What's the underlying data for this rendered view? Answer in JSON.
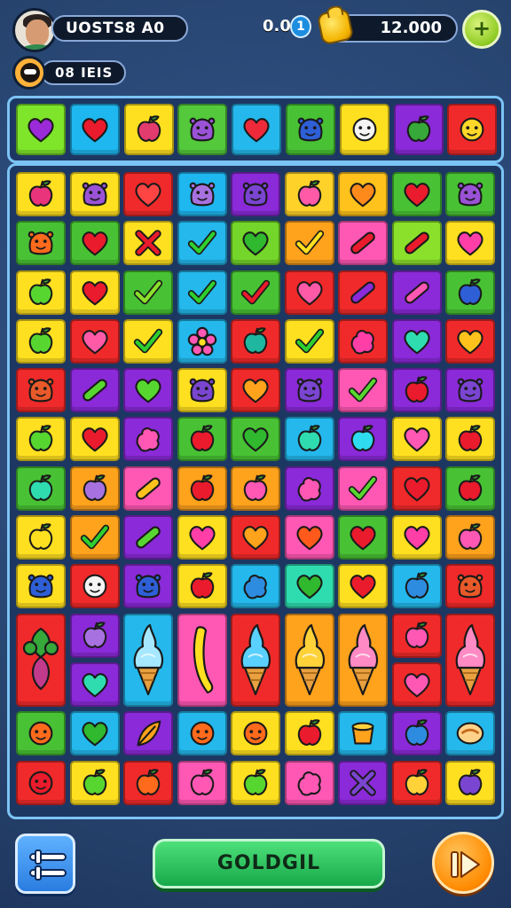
{
  "player": {
    "name": "UOSTS8 A0",
    "level_label": "08 IEIS"
  },
  "score": {
    "value": "0.0",
    "badge": "1"
  },
  "coins": {
    "value": "12.000"
  },
  "buttons": {
    "add": "+",
    "go_label": "GOLDGIL"
  },
  "colors": {
    "background": "#2c4a7e",
    "board_border": "#7cc3f5",
    "go_button": "#1fc25a",
    "play_button": "#ff8a00"
  },
  "target_strip": [
    {
      "bg": "#7ee52a",
      "icon": "heart-icon",
      "fg": "#9b2ad8"
    },
    {
      "bg": "#1fb7f0",
      "icon": "heart-icon",
      "fg": "#ea1b2c"
    },
    {
      "bg": "#ffe020",
      "icon": "fruit-icon",
      "fg": "#e23b6e"
    },
    {
      "bg": "#54c93b",
      "icon": "monster-icon",
      "fg": "#9a52d6"
    },
    {
      "bg": "#24b8ec",
      "icon": "heart-icon",
      "fg": "#ee2a3a"
    },
    {
      "bg": "#48c234",
      "icon": "monster-icon",
      "fg": "#2e5fd6"
    },
    {
      "bg": "#ffe020",
      "icon": "face-icon",
      "fg": "#f4f4f4"
    },
    {
      "bg": "#8a2ad8",
      "icon": "fruit-icon",
      "fg": "#37a83a"
    },
    {
      "bg": "#f02a2a",
      "icon": "face-icon",
      "fg": "#ffd82a"
    }
  ],
  "board": [
    {
      "bg": "#ffe020",
      "icon": "fruit-icon",
      "fg": "#e9337a"
    },
    {
      "bg": "#ffe020",
      "icon": "monster-icon",
      "fg": "#9a52d6"
    },
    {
      "bg": "#f02a2a",
      "icon": "heart-icon",
      "fg": "#ff4444"
    },
    {
      "bg": "#1fb7f0",
      "icon": "monster-icon",
      "fg": "#a772df"
    },
    {
      "bg": "#8a2ad8",
      "icon": "monster-icon",
      "fg": "#7a45d0"
    },
    {
      "bg": "#ffd22a",
      "icon": "fruit-icon",
      "fg": "#ff5aa8"
    },
    {
      "bg": "#ffc21c",
      "icon": "heart-icon",
      "fg": "#ff8a1c"
    },
    {
      "bg": "#48c234",
      "icon": "heart-icon",
      "fg": "#ea1b2c"
    },
    {
      "bg": "#48c234",
      "icon": "monster-icon",
      "fg": "#9a52d6"
    },
    {
      "bg": "#48c234",
      "icon": "monster-icon",
      "fg": "#ff6a1c"
    },
    {
      "bg": "#48c234",
      "icon": "heart-icon",
      "fg": "#ea1b2c"
    },
    {
      "bg": "#ffe020",
      "icon": "cross-icon",
      "fg": "#ea1b2c"
    },
    {
      "bg": "#24b8ec",
      "icon": "check-icon",
      "fg": "#2fcf2f"
    },
    {
      "bg": "#74d62a",
      "icon": "heart-icon",
      "fg": "#30b82e"
    },
    {
      "bg": "#ffa21c",
      "icon": "check-icon",
      "fg": "#ffe020"
    },
    {
      "bg": "#ff58b4",
      "icon": "bar-icon",
      "fg": "#ea1b2c"
    },
    {
      "bg": "#8ae02a",
      "icon": "bar-icon",
      "fg": "#ea1b2c"
    },
    {
      "bg": "#ffe020",
      "icon": "heart-icon",
      "fg": "#ff3ea8"
    },
    {
      "bg": "#ffe020",
      "icon": "fruit-icon",
      "fg": "#58d630"
    },
    {
      "bg": "#ffe020",
      "icon": "heart-icon",
      "fg": "#ea1b2c"
    },
    {
      "bg": "#48c234",
      "icon": "check-icon",
      "fg": "#8ae02a"
    },
    {
      "bg": "#24b8ec",
      "icon": "check-icon",
      "fg": "#2fcf2f"
    },
    {
      "bg": "#48c234",
      "icon": "check-icon",
      "fg": "#ea1b2c"
    },
    {
      "bg": "#f02a2a",
      "icon": "heart-icon",
      "fg": "#ff5aa8"
    },
    {
      "bg": "#f02a2a",
      "icon": "bar-icon",
      "fg": "#8a2ad8"
    },
    {
      "bg": "#8a2ad8",
      "icon": "bar-icon",
      "fg": "#ff58b4"
    },
    {
      "bg": "#48c234",
      "icon": "fruit-icon",
      "fg": "#2e5fd6"
    },
    {
      "bg": "#ffe020",
      "icon": "fruit-icon",
      "fg": "#58d630"
    },
    {
      "bg": "#f02a2a",
      "icon": "heart-icon",
      "fg": "#ff5aa8"
    },
    {
      "bg": "#ffe020",
      "icon": "check-icon",
      "fg": "#2fcf2f"
    },
    {
      "bg": "#24b8ec",
      "icon": "flower-icon",
      "fg": "#ff58b4"
    },
    {
      "bg": "#f02a2a",
      "icon": "fruit-icon",
      "fg": "#1fb7a0"
    },
    {
      "bg": "#ffe020",
      "icon": "check-icon",
      "fg": "#2fcf2f"
    },
    {
      "bg": "#f02a2a",
      "icon": "blob-icon",
      "fg": "#ff3ea8"
    },
    {
      "bg": "#8a2ad8",
      "icon": "heart-icon",
      "fg": "#2fdcb0"
    },
    {
      "bg": "#f02a2a",
      "icon": "heart-icon",
      "fg": "#ffc21c"
    },
    {
      "bg": "#f02a2a",
      "icon": "monster-icon",
      "fg": "#e85a2a"
    },
    {
      "bg": "#8a2ad8",
      "icon": "bar-icon",
      "fg": "#58d630"
    },
    {
      "bg": "#8a2ad8",
      "icon": "heart-icon",
      "fg": "#58d630"
    },
    {
      "bg": "#ffe020",
      "icon": "monster-icon",
      "fg": "#7a45d0"
    },
    {
      "bg": "#f02a2a",
      "icon": "heart-icon",
      "fg": "#ffa21c"
    },
    {
      "bg": "#8a2ad8",
      "icon": "monster-icon",
      "fg": "#7a45d0"
    },
    {
      "bg": "#ff58b4",
      "icon": "check-icon",
      "fg": "#58d630"
    },
    {
      "bg": "#8a2ad8",
      "icon": "fruit-icon",
      "fg": "#ea1b2c"
    },
    {
      "bg": "#8a2ad8",
      "icon": "monster-icon",
      "fg": "#7a45d0"
    },
    {
      "bg": "#ffe020",
      "icon": "fruit-icon",
      "fg": "#58d630"
    },
    {
      "bg": "#ffe020",
      "icon": "heart-icon",
      "fg": "#ea1b2c"
    },
    {
      "bg": "#8a2ad8",
      "icon": "blob-icon",
      "fg": "#ff58b4"
    },
    {
      "bg": "#48c234",
      "icon": "fruit-icon",
      "fg": "#ea1b2c"
    },
    {
      "bg": "#48c234",
      "icon": "heart-icon",
      "fg": "#30b82e"
    },
    {
      "bg": "#24b8ec",
      "icon": "fruit-icon",
      "fg": "#2fdcb0"
    },
    {
      "bg": "#8a2ad8",
      "icon": "fruit-icon",
      "fg": "#2fdcef"
    },
    {
      "bg": "#ffe020",
      "icon": "heart-icon",
      "fg": "#ff58b4"
    },
    {
      "bg": "#ffe020",
      "icon": "fruit-icon",
      "fg": "#ea1b2c"
    },
    {
      "bg": "#48c234",
      "icon": "fruit-icon",
      "fg": "#2fdcb0"
    },
    {
      "bg": "#ffa21c",
      "icon": "fruit-icon",
      "fg": "#a772df"
    },
    {
      "bg": "#ff58b4",
      "icon": "bar-icon",
      "fg": "#ffc21c"
    },
    {
      "bg": "#ffa21c",
      "icon": "fruit-icon",
      "fg": "#ea1b2c"
    },
    {
      "bg": "#ffa21c",
      "icon": "fruit-icon",
      "fg": "#ff58b4"
    },
    {
      "bg": "#8a2ad8",
      "icon": "blob-icon",
      "fg": "#ff58b4"
    },
    {
      "bg": "#ff58b4",
      "icon": "check-icon",
      "fg": "#58d630"
    },
    {
      "bg": "#f02a2a",
      "icon": "heart-icon",
      "fg": "#ea1b2c"
    },
    {
      "bg": "#48c234",
      "icon": "fruit-icon",
      "fg": "#ea1b2c"
    },
    {
      "bg": "#ffe020",
      "icon": "fruit-icon",
      "fg": "#ffe020"
    },
    {
      "bg": "#ffa21c",
      "icon": "check-icon",
      "fg": "#2fcf2f"
    },
    {
      "bg": "#8a2ad8",
      "icon": "bar-icon",
      "fg": "#58d630"
    },
    {
      "bg": "#ffe020",
      "icon": "heart-icon",
      "fg": "#ff3ea8"
    },
    {
      "bg": "#f02a2a",
      "icon": "heart-icon",
      "fg": "#ffa21c"
    },
    {
      "bg": "#ff58b4",
      "icon": "heart-icon",
      "fg": "#ff5a1c"
    },
    {
      "bg": "#48c234",
      "icon": "heart-icon",
      "fg": "#ea1b2c"
    },
    {
      "bg": "#ffe020",
      "icon": "heart-icon",
      "fg": "#ff3ea8"
    },
    {
      "bg": "#ffa21c",
      "icon": "fruit-icon",
      "fg": "#ff58b4"
    },
    {
      "bg": "#ffe020",
      "icon": "monster-icon",
      "fg": "#2e5fd6"
    },
    {
      "bg": "#f02a2a",
      "icon": "face-icon",
      "fg": "#f4f4f4"
    },
    {
      "bg": "#8a2ad8",
      "icon": "monster-icon",
      "fg": "#2e5fd6"
    },
    {
      "bg": "#ffe020",
      "icon": "fruit-icon",
      "fg": "#ea1b2c"
    },
    {
      "bg": "#24b8ec",
      "icon": "blob-icon",
      "fg": "#2e8ce0"
    },
    {
      "bg": "#2fdcb0",
      "icon": "heart-icon",
      "fg": "#30b82e"
    },
    {
      "bg": "#ffe020",
      "icon": "heart-icon",
      "fg": "#ea1b2c"
    },
    {
      "bg": "#24b8ec",
      "icon": "fruit-icon",
      "fg": "#2e8ce0"
    },
    {
      "bg": "#f02a2a",
      "icon": "monster-icon",
      "fg": "#e85a2a"
    },
    {
      "bg": "#f02a2a",
      "icon": "plant-icon",
      "fg": "#37a83a",
      "tall": true
    },
    {
      "bg": "#8a2ad8",
      "icon": "fruit-icon",
      "fg": "#a772df"
    },
    {
      "bg": "#24b8ec",
      "icon": "icecream-icon",
      "fg": "#a6e8ff",
      "tall": true
    },
    {
      "bg": "#ff58b4",
      "icon": "banana-icon",
      "fg": "#ffe020",
      "tall": true
    },
    {
      "bg": "#f02a2a",
      "icon": "icecream-icon",
      "fg": "#5ad0ff",
      "tall": true
    },
    {
      "bg": "#ffa21c",
      "icon": "icecream-icon",
      "fg": "#ffd23a",
      "tall": true
    },
    {
      "bg": "#ffa21c",
      "icon": "icecream-icon",
      "fg": "#ff8ac4",
      "tall": true
    },
    {
      "bg": "#f02a2a",
      "icon": "fruit-icon",
      "fg": "#ff58b4"
    },
    {
      "bg": "#f02a2a",
      "icon": "icecream-icon",
      "fg": "#ff8ac4",
      "tall": true
    },
    {
      "bg": "#8a2ad8",
      "icon": "heart-icon",
      "fg": "#2fdcb0"
    },
    {
      "bg": "#f02a2a",
      "icon": "heart-icon",
      "fg": "#ff58b4"
    },
    {
      "bg": "#48c234",
      "icon": "face-icon",
      "fg": "#ff6a1c"
    },
    {
      "bg": "#24b8ec",
      "icon": "heart-icon",
      "fg": "#30b82e"
    },
    {
      "bg": "#8a2ad8",
      "icon": "leaf-icon",
      "fg": "#ffa21c"
    },
    {
      "bg": "#24b8ec",
      "icon": "face-icon",
      "fg": "#ff6a1c"
    },
    {
      "bg": "#ffe020",
      "icon": "face-icon",
      "fg": "#ff6a1c"
    },
    {
      "bg": "#ffe020",
      "icon": "fruit-icon",
      "fg": "#ea1b2c"
    },
    {
      "bg": "#24b8ec",
      "icon": "bucket-icon",
      "fg": "#ffa21c"
    },
    {
      "bg": "#8a2ad8",
      "icon": "fruit-icon",
      "fg": "#2e8ce0"
    },
    {
      "bg": "#24b8ec",
      "icon": "cookie-icon",
      "fg": "#ffd28a"
    },
    {
      "bg": "#f02a2a",
      "icon": "face-icon",
      "fg": "#ea1b2c"
    },
    {
      "bg": "#ffe020",
      "icon": "fruit-icon",
      "fg": "#58d630"
    },
    {
      "bg": "#f02a2a",
      "icon": "fruit-icon",
      "fg": "#ff6a1c"
    },
    {
      "bg": "#ff58b4",
      "icon": "fruit-icon",
      "fg": "#ff58b4"
    },
    {
      "bg": "#ffe020",
      "icon": "fruit-icon",
      "fg": "#58d630"
    },
    {
      "bg": "#ff58b4",
      "icon": "blob-icon",
      "fg": "#ff58b4"
    },
    {
      "bg": "#8a2ad8",
      "icon": "cross-icon",
      "fg": "#7a45d0"
    },
    {
      "bg": "#f02a2a",
      "icon": "fruit-icon",
      "fg": "#ffd23a"
    },
    {
      "bg": "#ffe020",
      "icon": "fruit-icon",
      "fg": "#7a45d0"
    }
  ]
}
